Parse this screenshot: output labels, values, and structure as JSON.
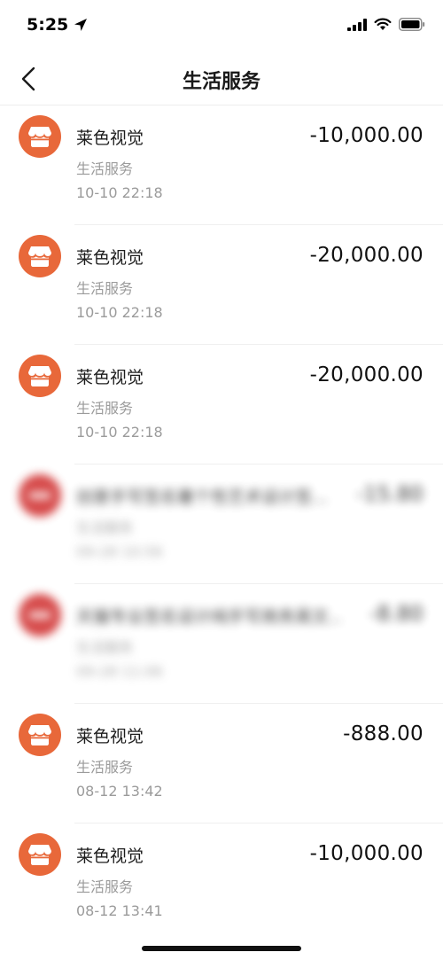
{
  "status": {
    "time": "5:25"
  },
  "header": {
    "title": "生活服务"
  },
  "transactions": [
    {
      "name": "莱色视觉",
      "category": "生活服务",
      "time": "10-10  22:18",
      "amount": "-10,000.00",
      "blurred": false
    },
    {
      "name": "莱色视觉",
      "category": "生活服务",
      "time": "10-10  22:18",
      "amount": "-20,000.00",
      "blurred": false
    },
    {
      "name": "莱色视觉",
      "category": "生活服务",
      "time": "10-10  22:18",
      "amount": "-20,000.00",
      "blurred": false
    },
    {
      "name": "创意手写签名署个性艺术设计签...",
      "category": "生活服务",
      "time": "09-28  10:56",
      "amount": "-15.80",
      "blurred": true
    },
    {
      "name": "天猫专业签名设计纯手写商务英文...",
      "category": "生活服务",
      "time": "09-28  11:06",
      "amount": "-8.80",
      "blurred": true
    },
    {
      "name": "莱色视觉",
      "category": "生活服务",
      "time": "08-12  13:42",
      "amount": "-888.00",
      "blurred": false
    },
    {
      "name": "莱色视觉",
      "category": "生活服务",
      "time": "08-12  13:41",
      "amount": "-10,000.00",
      "blurred": false
    }
  ],
  "colors": {
    "shop_avatar": "#e8683a",
    "tmall_avatar": "#cf2b2b"
  }
}
